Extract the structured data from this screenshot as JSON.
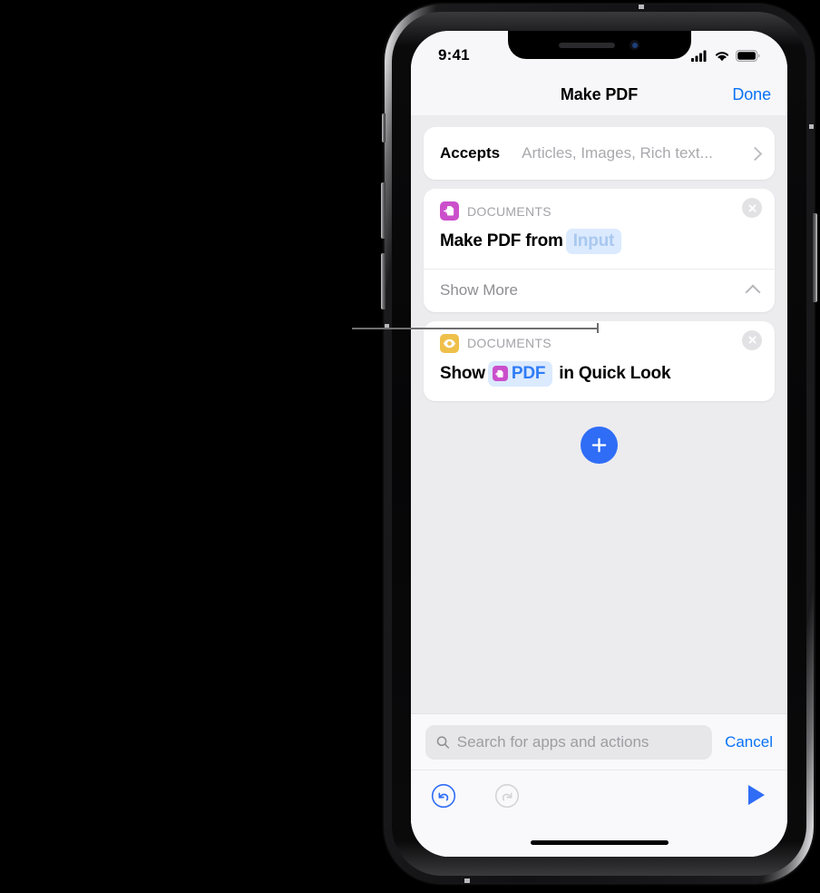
{
  "status_bar": {
    "time": "9:41",
    "cellular_icon": "signal-bars-icon",
    "wifi_icon": "wifi-icon",
    "battery_icon": "battery-icon"
  },
  "nav_bar": {
    "title": "Make PDF",
    "done_label": "Done"
  },
  "accepts": {
    "label": "Accepts",
    "value": "Articles, Images, Rich text...",
    "chevron_icon": "chevron-right-icon"
  },
  "actions": [
    {
      "category": "DOCUMENTS",
      "app_icon": "make-pdf-icon",
      "close_icon": "close-circle-icon",
      "title_before": "Make PDF from",
      "token": "Input",
      "title_after": "",
      "show_more_label": "Show More",
      "show_more_chevron_icon": "chevron-up-icon"
    },
    {
      "category": "DOCUMENTS",
      "app_icon": "quick-look-eye-icon",
      "close_icon": "close-circle-icon",
      "title_before": "Show",
      "token": "PDF",
      "token_icon": "pdf-file-icon",
      "title_after": "in Quick Look"
    }
  ],
  "add_button": {
    "icon": "plus-icon",
    "color": "#2f6df6"
  },
  "search": {
    "placeholder": "Search for apps and actions",
    "value": "",
    "icon": "search-icon",
    "cancel_label": "Cancel"
  },
  "toolbar": {
    "undo_icon": "undo-icon",
    "redo_icon": "redo-icon",
    "run_icon": "play-icon",
    "undo_enabled": true,
    "redo_enabled": false
  },
  "colors": {
    "accent_blue": "#0a72f5",
    "add_blue": "#2f6df6",
    "documents_magenta": "#cb4fcb",
    "quicklook_yellow": "#eec04a",
    "token_blue_bg": "#dbeafe",
    "content_bg": "#ececef"
  }
}
